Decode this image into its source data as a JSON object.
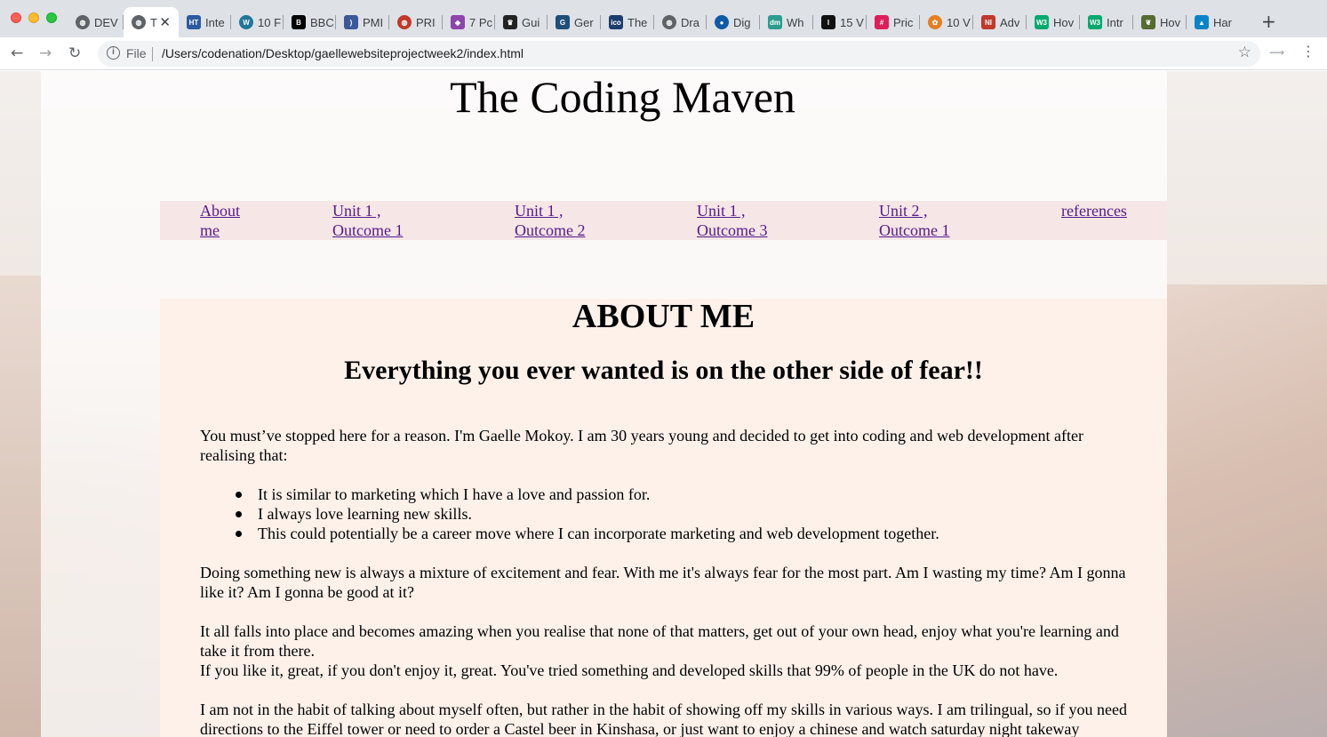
{
  "browser": {
    "tabs": [
      {
        "title": "DEV",
        "favicon": "globe-icon",
        "color": "#5f6368"
      },
      {
        "title": "T",
        "favicon": "globe-icon",
        "color": "#5f6368",
        "active": true
      },
      {
        "title": "Inte",
        "favicon": "html-doc-icon",
        "color": "#2c5aa0"
      },
      {
        "title": "10 F",
        "favicon": "wordpress-icon",
        "color": "#21759b"
      },
      {
        "title": "BBC",
        "favicon": "bbc-icon",
        "color": "#000000"
      },
      {
        "title": "PMI",
        "favicon": "rss-icon",
        "color": "#3b5998"
      },
      {
        "title": "PRI",
        "favicon": "globe-red-icon",
        "color": "#c0392b"
      },
      {
        "title": "7 Pc",
        "favicon": "diamond-icon",
        "color": "#8e44ad"
      },
      {
        "title": "Gui",
        "favicon": "crown-icon",
        "color": "#222222"
      },
      {
        "title": "Ger",
        "favicon": "gov-icon",
        "color": "#1f4e79"
      },
      {
        "title": "The",
        "favicon": "ico-icon",
        "color": "#1d3c6e"
      },
      {
        "title": "Dra",
        "favicon": "globe-icon",
        "color": "#5f6368"
      },
      {
        "title": "Dig",
        "favicon": "drop-icon",
        "color": "#0e5aa7"
      },
      {
        "title": "Wh",
        "favicon": "dm-icon",
        "color": "#2a9d8f"
      },
      {
        "title": "15 V",
        "favicon": "i-icon",
        "color": "#111111"
      },
      {
        "title": "Pric",
        "favicon": "slack-icon",
        "color": "#e01e5a"
      },
      {
        "title": "10 V",
        "favicon": "lotus-icon",
        "color": "#e67e22"
      },
      {
        "title": "Adv",
        "favicon": "ni-icon",
        "color": "#c0392b"
      },
      {
        "title": "Hov",
        "favicon": "w3-icon",
        "color": "#04aa6d"
      },
      {
        "title": "Intr",
        "favicon": "w3-icon",
        "color": "#04aa6d"
      },
      {
        "title": "Hov",
        "favicon": "leaf-icon",
        "color": "#556b2f"
      },
      {
        "title": "Har",
        "favicon": "grad-cap-icon",
        "color": "#0a84c6"
      }
    ],
    "url_scheme": "File",
    "url": "/Users/codenation/Desktop/gaellewebsiteprojectweek2/index.html"
  },
  "site": {
    "title": "The Coding Maven",
    "nav": [
      {
        "line1": "About",
        "line2": "me"
      },
      {
        "line1": "Unit 1 ,",
        "line2": "Outcome 1"
      },
      {
        "line1": "Unit 1 ,",
        "line2": "Outcome 2"
      },
      {
        "line1": "Unit 1 ,",
        "line2": "Outcome 3"
      },
      {
        "line1": "Unit 2 ,",
        "line2": "Outcome 1"
      },
      {
        "line1": "references",
        "line2": ""
      }
    ],
    "heading": "ABOUT ME",
    "subheading": "Everything you ever wanted is on the other side of fear!!",
    "intro": "You must’ve stopped here for a reason. I'm Gaelle Mokoy. I am 30 years young and decided to get into coding and web development after realising that:",
    "bullets": [
      "It is similar to marketing which I have a love and passion for.",
      "I always love learning new skills.",
      "This could potentially be a career move where I can incorporate marketing and web development together."
    ],
    "para2": "Doing something new is always a mixture of excitement and fear. With me it's always fear for the most part. Am I wasting my time? Am I gonna like it? Am I gonna be good at it?",
    "para3a": "It all falls into place and becomes amazing when you realise that none of that matters, get out of your own head, enjoy what you're learning and take it from there.",
    "para3b": "If you like it, great, if you don't enjoy it, great. You've tried something and developed skills that 99% of people in the UK do not have.",
    "para4": "I am not in the habit of talking about myself often, but rather in the habit of showing off my skills in various ways. I am trilingual, so if you need directions to the Eiffel tower or need to order a Castel beer in Kinshasa, or just want to enjoy a chinese and watch saturday night takeway"
  }
}
